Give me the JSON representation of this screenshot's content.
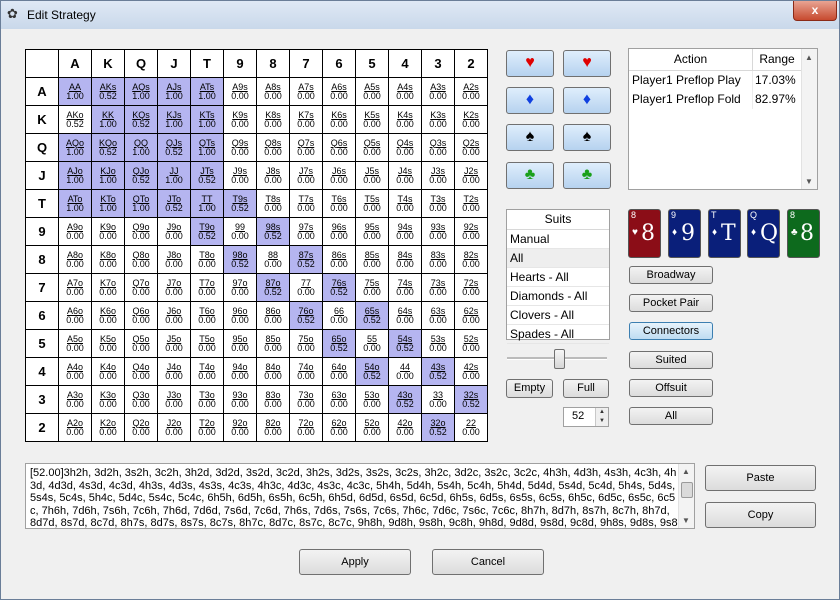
{
  "window": {
    "title": "Edit Strategy",
    "close_label": "x"
  },
  "grid": {
    "ranks": [
      "A",
      "K",
      "Q",
      "J",
      "T",
      "9",
      "8",
      "7",
      "6",
      "5",
      "4",
      "3",
      "2"
    ],
    "cells": [
      [
        [
          "AA",
          "1.00",
          1
        ],
        [
          "AKs",
          "0.52",
          1
        ],
        [
          "AQs",
          "1.00",
          1
        ],
        [
          "AJs",
          "1.00",
          1
        ],
        [
          "ATs",
          "1.00",
          1
        ],
        [
          "A9s",
          "0.00",
          0
        ],
        [
          "A8s",
          "0.00",
          0
        ],
        [
          "A7s",
          "0.00",
          0
        ],
        [
          "A6s",
          "0.00",
          0
        ],
        [
          "A5s",
          "0.00",
          0
        ],
        [
          "A4s",
          "0.00",
          0
        ],
        [
          "A3s",
          "0.00",
          0
        ],
        [
          "A2s",
          "0.00",
          0
        ]
      ],
      [
        [
          "AKo",
          "0.52",
          0
        ],
        [
          "KK",
          "1.00",
          1
        ],
        [
          "KQs",
          "0.52",
          1
        ],
        [
          "KJs",
          "1.00",
          1
        ],
        [
          "KTs",
          "1.00",
          1
        ],
        [
          "K9s",
          "0.00",
          0
        ],
        [
          "K8s",
          "0.00",
          0
        ],
        [
          "K7s",
          "0.00",
          0
        ],
        [
          "K6s",
          "0.00",
          0
        ],
        [
          "K5s",
          "0.00",
          0
        ],
        [
          "K4s",
          "0.00",
          0
        ],
        [
          "K3s",
          "0.00",
          0
        ],
        [
          "K2s",
          "0.00",
          0
        ]
      ],
      [
        [
          "AQo",
          "1.00",
          1
        ],
        [
          "KQo",
          "0.52",
          1
        ],
        [
          "QQ",
          "1.00",
          1
        ],
        [
          "QJs",
          "0.52",
          1
        ],
        [
          "QTs",
          "1.00",
          1
        ],
        [
          "Q9s",
          "0.00",
          0
        ],
        [
          "Q8s",
          "0.00",
          0
        ],
        [
          "Q7s",
          "0.00",
          0
        ],
        [
          "Q6s",
          "0.00",
          0
        ],
        [
          "Q5s",
          "0.00",
          0
        ],
        [
          "Q4s",
          "0.00",
          0
        ],
        [
          "Q3s",
          "0.00",
          0
        ],
        [
          "Q2s",
          "0.00",
          0
        ]
      ],
      [
        [
          "AJo",
          "1.00",
          1
        ],
        [
          "KJo",
          "1.00",
          1
        ],
        [
          "QJo",
          "0.52",
          1
        ],
        [
          "JJ",
          "1.00",
          1
        ],
        [
          "JTs",
          "0.52",
          1
        ],
        [
          "J9s",
          "0.00",
          0
        ],
        [
          "J8s",
          "0.00",
          0
        ],
        [
          "J7s",
          "0.00",
          0
        ],
        [
          "J6s",
          "0.00",
          0
        ],
        [
          "J5s",
          "0.00",
          0
        ],
        [
          "J4s",
          "0.00",
          0
        ],
        [
          "J3s",
          "0.00",
          0
        ],
        [
          "J2s",
          "0.00",
          0
        ]
      ],
      [
        [
          "ATo",
          "1.00",
          1
        ],
        [
          "KTo",
          "1.00",
          1
        ],
        [
          "QTo",
          "1.00",
          1
        ],
        [
          "JTo",
          "0.52",
          1
        ],
        [
          "TT",
          "1.00",
          1
        ],
        [
          "T9s",
          "0.52",
          1
        ],
        [
          "T8s",
          "0.00",
          0
        ],
        [
          "T7s",
          "0.00",
          0
        ],
        [
          "T6s",
          "0.00",
          0
        ],
        [
          "T5s",
          "0.00",
          0
        ],
        [
          "T4s",
          "0.00",
          0
        ],
        [
          "T3s",
          "0.00",
          0
        ],
        [
          "T2s",
          "0.00",
          0
        ]
      ],
      [
        [
          "A9o",
          "0.00",
          0
        ],
        [
          "K9o",
          "0.00",
          0
        ],
        [
          "Q9o",
          "0.00",
          0
        ],
        [
          "J9o",
          "0.00",
          0
        ],
        [
          "T9o",
          "0.52",
          1
        ],
        [
          "99",
          "0.00",
          0
        ],
        [
          "98s",
          "0.52",
          1
        ],
        [
          "97s",
          "0.00",
          0
        ],
        [
          "96s",
          "0.00",
          0
        ],
        [
          "95s",
          "0.00",
          0
        ],
        [
          "94s",
          "0.00",
          0
        ],
        [
          "93s",
          "0.00",
          0
        ],
        [
          "92s",
          "0.00",
          0
        ]
      ],
      [
        [
          "A8o",
          "0.00",
          0
        ],
        [
          "K8o",
          "0.00",
          0
        ],
        [
          "Q8o",
          "0.00",
          0
        ],
        [
          "J8o",
          "0.00",
          0
        ],
        [
          "T8o",
          "0.00",
          0
        ],
        [
          "98o",
          "0.52",
          1
        ],
        [
          "88",
          "0.00",
          0
        ],
        [
          "87s",
          "0.52",
          1
        ],
        [
          "86s",
          "0.00",
          0
        ],
        [
          "85s",
          "0.00",
          0
        ],
        [
          "84s",
          "0.00",
          0
        ],
        [
          "83s",
          "0.00",
          0
        ],
        [
          "82s",
          "0.00",
          0
        ]
      ],
      [
        [
          "A7o",
          "0.00",
          0
        ],
        [
          "K7o",
          "0.00",
          0
        ],
        [
          "Q7o",
          "0.00",
          0
        ],
        [
          "J7o",
          "0.00",
          0
        ],
        [
          "T7o",
          "0.00",
          0
        ],
        [
          "97o",
          "0.00",
          0
        ],
        [
          "87o",
          "0.52",
          1
        ],
        [
          "77",
          "0.00",
          0
        ],
        [
          "76s",
          "0.52",
          1
        ],
        [
          "75s",
          "0.00",
          0
        ],
        [
          "74s",
          "0.00",
          0
        ],
        [
          "73s",
          "0.00",
          0
        ],
        [
          "72s",
          "0.00",
          0
        ]
      ],
      [
        [
          "A6o",
          "0.00",
          0
        ],
        [
          "K6o",
          "0.00",
          0
        ],
        [
          "Q6o",
          "0.00",
          0
        ],
        [
          "J6o",
          "0.00",
          0
        ],
        [
          "T6o",
          "0.00",
          0
        ],
        [
          "96o",
          "0.00",
          0
        ],
        [
          "86o",
          "0.00",
          0
        ],
        [
          "76o",
          "0.52",
          1
        ],
        [
          "66",
          "0.00",
          0
        ],
        [
          "65s",
          "0.52",
          1
        ],
        [
          "64s",
          "0.00",
          0
        ],
        [
          "63s",
          "0.00",
          0
        ],
        [
          "62s",
          "0.00",
          0
        ]
      ],
      [
        [
          "A5o",
          "0.00",
          0
        ],
        [
          "K5o",
          "0.00",
          0
        ],
        [
          "Q5o",
          "0.00",
          0
        ],
        [
          "J5o",
          "0.00",
          0
        ],
        [
          "T5o",
          "0.00",
          0
        ],
        [
          "95o",
          "0.00",
          0
        ],
        [
          "85o",
          "0.00",
          0
        ],
        [
          "75o",
          "0.00",
          0
        ],
        [
          "65o",
          "0.52",
          1
        ],
        [
          "55",
          "0.00",
          0
        ],
        [
          "54s",
          "0.52",
          1
        ],
        [
          "53s",
          "0.00",
          0
        ],
        [
          "52s",
          "0.00",
          0
        ]
      ],
      [
        [
          "A4o",
          "0.00",
          0
        ],
        [
          "K4o",
          "0.00",
          0
        ],
        [
          "Q4o",
          "0.00",
          0
        ],
        [
          "J4o",
          "0.00",
          0
        ],
        [
          "T4o",
          "0.00",
          0
        ],
        [
          "94o",
          "0.00",
          0
        ],
        [
          "84o",
          "0.00",
          0
        ],
        [
          "74o",
          "0.00",
          0
        ],
        [
          "64o",
          "0.00",
          0
        ],
        [
          "54o",
          "0.52",
          1
        ],
        [
          "44",
          "0.00",
          0
        ],
        [
          "43s",
          "0.52",
          1
        ],
        [
          "42s",
          "0.00",
          0
        ]
      ],
      [
        [
          "A3o",
          "0.00",
          0
        ],
        [
          "K3o",
          "0.00",
          0
        ],
        [
          "Q3o",
          "0.00",
          0
        ],
        [
          "J3o",
          "0.00",
          0
        ],
        [
          "T3o",
          "0.00",
          0
        ],
        [
          "93o",
          "0.00",
          0
        ],
        [
          "83o",
          "0.00",
          0
        ],
        [
          "73o",
          "0.00",
          0
        ],
        [
          "63o",
          "0.00",
          0
        ],
        [
          "53o",
          "0.00",
          0
        ],
        [
          "43o",
          "0.52",
          1
        ],
        [
          "33",
          "0.00",
          0
        ],
        [
          "32s",
          "0.52",
          1
        ]
      ],
      [
        [
          "A2o",
          "0.00",
          0
        ],
        [
          "K2o",
          "0.00",
          0
        ],
        [
          "Q2o",
          "0.00",
          0
        ],
        [
          "J2o",
          "0.00",
          0
        ],
        [
          "T2o",
          "0.00",
          0
        ],
        [
          "92o",
          "0.00",
          0
        ],
        [
          "82o",
          "0.00",
          0
        ],
        [
          "72o",
          "0.00",
          0
        ],
        [
          "62o",
          "0.00",
          0
        ],
        [
          "52o",
          "0.00",
          0
        ],
        [
          "42o",
          "0.00",
          0
        ],
        [
          "32o",
          "0.52",
          1
        ],
        [
          "22",
          "0.00",
          0
        ]
      ]
    ]
  },
  "suit_buttons": [
    {
      "glyph": "♥",
      "color": "red",
      "icon": "heart-icon"
    },
    {
      "glyph": "♥",
      "color": "red",
      "icon": "heart-icon"
    },
    {
      "glyph": "♦",
      "color": "blue",
      "icon": "diamond-icon"
    },
    {
      "glyph": "♦",
      "color": "blue",
      "icon": "diamond-icon"
    },
    {
      "glyph": "♠",
      "color": "black",
      "icon": "spade-icon"
    },
    {
      "glyph": "♠",
      "color": "black",
      "icon": "spade-icon"
    },
    {
      "glyph": "♣",
      "color": "green",
      "icon": "club-icon"
    },
    {
      "glyph": "♣",
      "color": "green",
      "icon": "club-icon"
    }
  ],
  "actions": {
    "header_action": "Action",
    "header_range": "Range",
    "rows": [
      {
        "action": "Player1 Preflop Play",
        "range": "17.03%"
      },
      {
        "action": "Player1 Preflop Fold",
        "range": "82.97%"
      }
    ]
  },
  "suits_list": {
    "header": "Suits",
    "items": [
      "Manual",
      "All",
      "Hearts - All",
      "Diamonds - All",
      "Clovers - All",
      "Spades - All"
    ],
    "selected": "All"
  },
  "controls": {
    "empty_label": "Empty",
    "full_label": "Full",
    "spin_value": "52",
    "slider_fraction": 0.52
  },
  "cards": [
    {
      "rank": "8",
      "suit": "♥",
      "big": "8",
      "color": "#8b0d17"
    },
    {
      "rank": "9",
      "suit": "♦",
      "big": "9",
      "color": "#0a1f7a"
    },
    {
      "rank": "T",
      "suit": "♦",
      "big": "T",
      "color": "#0a1f7a"
    },
    {
      "rank": "Q",
      "suit": "♦",
      "big": "Q",
      "color": "#0a1f7a"
    },
    {
      "rank": "8",
      "suit": "♣",
      "big": "8",
      "color": "#0d6a1d"
    }
  ],
  "range_buttons": [
    "Broadway",
    "Pocket Pair",
    "Connectors",
    "Suited",
    "Offsuit",
    "All"
  ],
  "range_text": "[52.00]3h2h, 3d2h, 3s2h, 3c2h, 3h2d, 3d2d, 3s2d, 3c2d, 3h2s, 3d2s, 3s2s, 3c2s, 3h2c, 3d2c, 3s2c, 3c2c, 4h3h, 4d3h, 4s3h, 4c3h, 4h3d, 4d3d, 4s3d, 4c3d, 4h3s, 4d3s, 4s3s, 4c3s, 4h3c, 4d3c, 4s3c, 4c3c, 5h4h, 5d4h, 5s4h, 5c4h, 5h4d, 5d4d, 5s4d, 5c4d, 5h4s, 5d4s, 5s4s, 5c4s, 5h4c, 5d4c, 5s4c, 5c4c, 6h5h, 6d5h, 6s5h, 6c5h, 6h5d, 6d5d, 6s5d, 6c5d, 6h5s, 6d5s, 6s5s, 6c5s, 6h5c, 6d5c, 6s5c, 6c5c, 7h6h, 7d6h, 7s6h, 7c6h, 7h6d, 7d6d, 7s6d, 7c6d, 7h6s, 7d6s, 7s6s, 7c6s, 7h6c, 7d6c, 7s6c, 7c6c, 8h7h, 8d7h, 8s7h, 8c7h, 8h7d, 8d7d, 8s7d, 8c7d, 8h7s, 8d7s, 8s7s, 8c7s, 8h7c, 8d7c, 8s7c, 8c7c, 9h8h, 9d8h, 9s8h, 9c8h, 9h8d, 9d8d, 9s8d, 9c8d, 9h8s, 9d8s, 9s8s, 9c8s, 9h8c,",
  "side_buttons": {
    "paste": "Paste",
    "copy": "Copy"
  },
  "footer": {
    "apply": "Apply",
    "cancel": "Cancel"
  }
}
